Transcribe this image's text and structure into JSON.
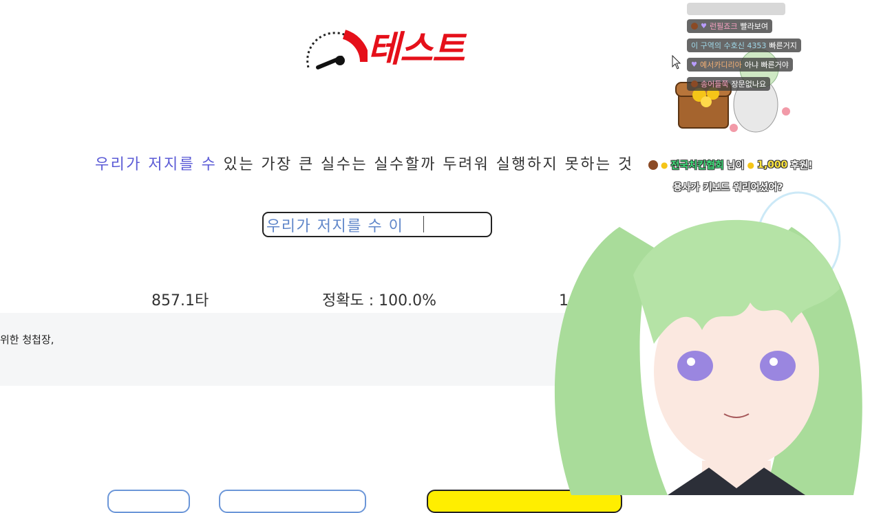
{
  "logo": {
    "text": "테스트"
  },
  "typing_test": {
    "sentence_typed": "우리가 저지를 수",
    "sentence_rest": " 있는 가장 큰 실수는 실수할까 두려워 실행하지 못하는 것",
    "input_value": "우리가 저지를 수 이"
  },
  "stats": {
    "speed": "857.1타",
    "accuracy": "정확도 : 100.0%",
    "extra": "1"
  },
  "info_band": {
    "text": "위한 청첩장,"
  },
  "chat": {
    "messages": [
      {
        "nick": "런필죠크",
        "text": "빨라보여"
      },
      {
        "nick": "이 구역의 수호신 4353",
        "text": "빠른거지"
      },
      {
        "nick": "예서카디리아",
        "text": "아냐 빠른거야"
      },
      {
        "nick": "송어들쭉",
        "text": "장문없나요"
      }
    ],
    "donation": {
      "name": "전국치킨협회",
      "suffix": "님이",
      "amount": "1,000",
      "unit": "후원!",
      "message": "용사가 키보드 워리어셨어?"
    }
  },
  "colors": {
    "logo_red": "#e5101a",
    "typed_text": "#5b5bd6",
    "input_text": "#5f86c9",
    "accent_yellow": "#ffee00"
  }
}
